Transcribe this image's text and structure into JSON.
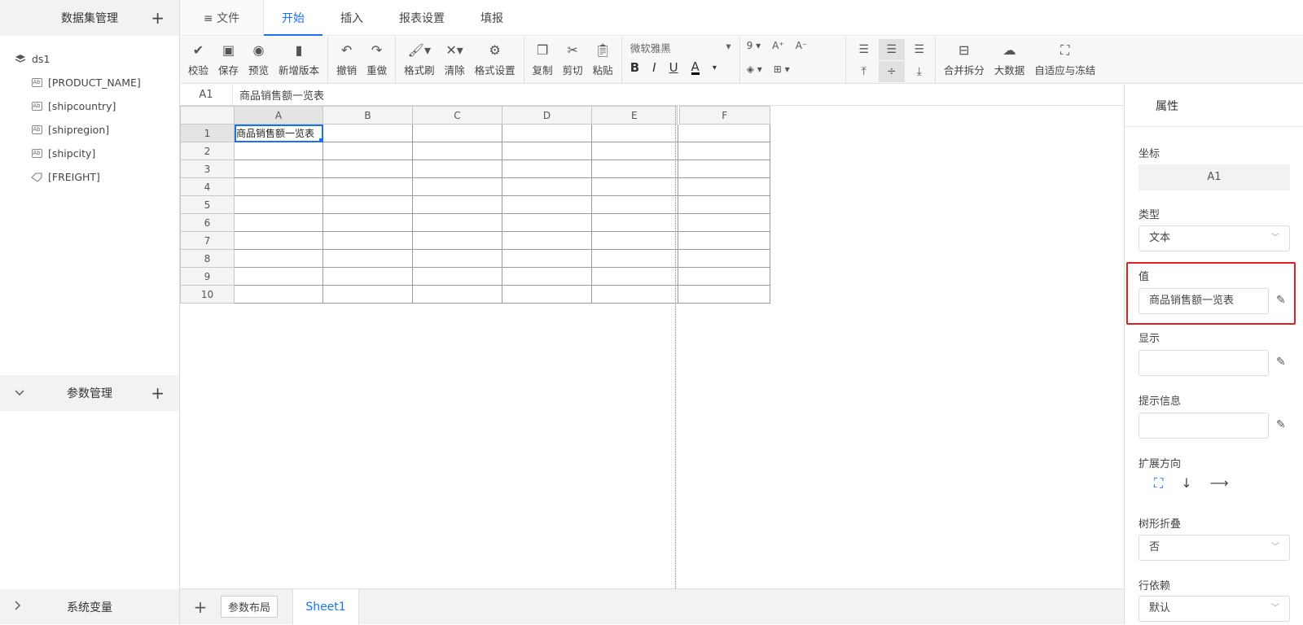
{
  "left_panel": {
    "dataset_title": "数据集管理",
    "plus": "+",
    "dataset": {
      "name": "ds1",
      "fields": [
        "[PRODUCT_NAME]",
        "[shipcountry]",
        "[shipregion]",
        "[shipcity]",
        "[FREIGHT]"
      ]
    },
    "param_title": "参数管理",
    "sysvar_title": "系统变量"
  },
  "topbar": {
    "file_label": "≡ 文件",
    "tabs": [
      "开始",
      "插入",
      "报表设置",
      "填报"
    ],
    "active_tab": "开始"
  },
  "toolbar": {
    "group1": [
      "校验",
      "保存",
      "预览",
      "新增版本"
    ],
    "group2": [
      "撤销",
      "重做"
    ],
    "group3": [
      "格式刷",
      "清除",
      "格式设置"
    ],
    "group4": [
      "复制",
      "剪切",
      "粘贴"
    ],
    "font_name": "微软雅黑",
    "font_size": "9",
    "group5": [
      "合并拆分",
      "大数据",
      "自适应与冻结"
    ]
  },
  "formula_bar": {
    "cell_ref": "A1",
    "value": "商品销售额一览表"
  },
  "grid": {
    "columns": [
      "A",
      "B",
      "C",
      "D",
      "E",
      "F"
    ],
    "rows": [
      "1",
      "2",
      "3",
      "4",
      "5",
      "6",
      "7",
      "8",
      "9",
      "10"
    ],
    "a1_value": "商品销售额一览表"
  },
  "sheetbar": {
    "add": "+",
    "param_layout": "参数布局",
    "sheet_name": "Sheet1"
  },
  "properties": {
    "title": "属性",
    "coord_label": "坐标",
    "coord_value": "A1",
    "type_label": "类型",
    "type_value": "文本",
    "value_label": "值",
    "value_value": "商品销售额一览表",
    "display_label": "显示",
    "tip_label": "提示信息",
    "expand_label": "扩展方向",
    "tree_label": "树形折叠",
    "tree_value": "否",
    "rowdep_label": "行依赖",
    "rowdep_value": "默认"
  },
  "colors": {
    "accent": "#1a73e8",
    "highlight_border": "#e02020"
  }
}
